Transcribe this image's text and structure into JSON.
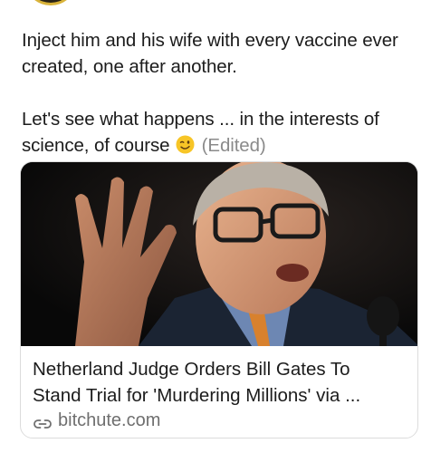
{
  "post": {
    "paragraph1": "Inject him and his wife with every vaccine ever created, one after another.",
    "paragraph2_text": "Let's see what happens ... in the interests of science, of course",
    "emoji": "winking-face",
    "edited_label": "(Edited)"
  },
  "link_preview": {
    "title_line1": "Netherland Judge Orders Bill Gates To",
    "title_line2": "Stand Trial for 'Murdering Millions' via ...",
    "domain": "bitchute.com",
    "icon": "link-icon"
  }
}
